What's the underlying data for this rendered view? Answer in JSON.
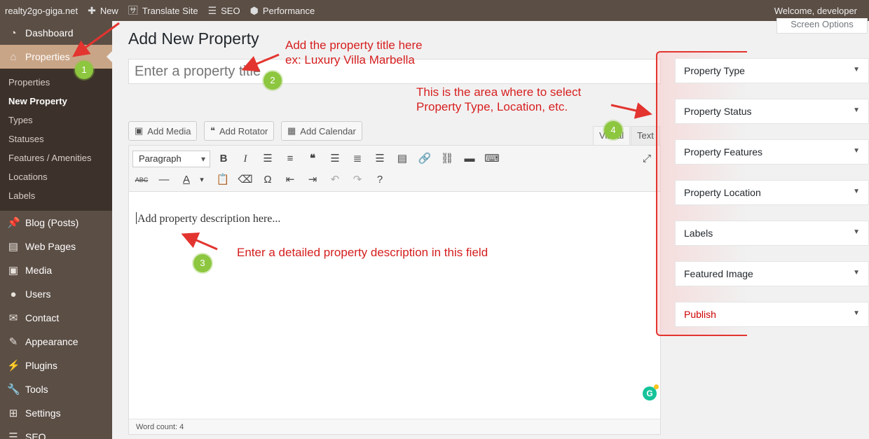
{
  "adminbar": {
    "site": "realty2go-giga.net",
    "new": "New",
    "translate": "Translate Site",
    "seo": "SEO",
    "performance": "Performance",
    "welcome": "Welcome, developer"
  },
  "sidebar": {
    "dashboard": "Dashboard",
    "properties": "Properties",
    "submenu": [
      "Properties",
      "New Property",
      "Types",
      "Statuses",
      "Features / Amenities",
      "Locations",
      "Labels"
    ],
    "items": [
      "Blog (Posts)",
      "Web Pages",
      "Media",
      "Users",
      "Contact",
      "Appearance",
      "Plugins",
      "Tools",
      "Settings",
      "SEO"
    ]
  },
  "page": {
    "title": "Add New Property",
    "screen_options": "Screen Options",
    "title_placeholder": "Enter a property title"
  },
  "media_buttons": [
    "Add Media",
    "Add Rotator",
    "Add Calendar"
  ],
  "editor": {
    "tab_visual": "Visual",
    "tab_text": "Text",
    "format": "Paragraph",
    "content": "Add property description here...",
    "word_count": "Word count: 4"
  },
  "metaboxes": [
    "Property Type",
    "Property Status",
    "Property Features",
    "Property Location",
    "Labels",
    "Featured Image",
    "Publish"
  ],
  "annotations": {
    "title_note_1": "Add the property title here",
    "title_note_2": "ex: Luxury Villa Marbella",
    "area_note_1": "This is the area where to select",
    "area_note_2": "Property Type, Location, etc.",
    "desc_note": "Enter a detailed property description in this field",
    "badges": [
      "1",
      "2",
      "3",
      "4"
    ]
  },
  "colors": {
    "admin_bg": "#5b4e45",
    "submenu_bg": "#3d322b",
    "current_menu": "#c9a587",
    "annotation": "#d51d1d",
    "badge": "#8dc63f"
  }
}
